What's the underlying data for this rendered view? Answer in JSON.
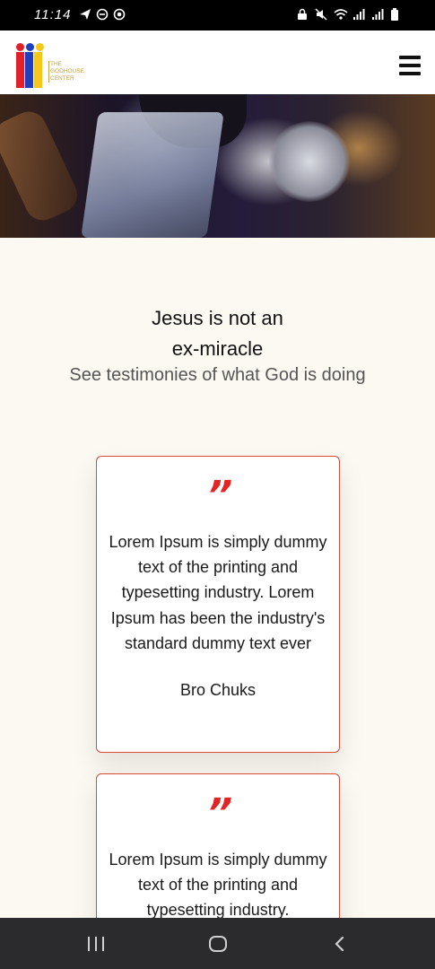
{
  "status_bar": {
    "time": "11:14",
    "left_icons": [
      "telegram-icon",
      "dnd-icon",
      "record-icon"
    ],
    "right_icons": [
      "lock-icon",
      "mute-icon",
      "wifi-icon",
      "signal-icon",
      "signal-icon",
      "battery-icon"
    ]
  },
  "header": {
    "logo_text": [
      "THE",
      "GODHOUSE",
      "CENTER"
    ],
    "logo_colors": {
      "red": "#e0202a",
      "blue": "#1f3fbf",
      "yellow": "#f4c81a"
    },
    "menu_icon": "hamburger-icon"
  },
  "hero": {
    "description_icon": "hero-image"
  },
  "testimonials": {
    "title_line1": "Jesus is not an",
    "title_line2": "ex-miracle",
    "subtitle": "See testimonies of what God is doing",
    "cards": [
      {
        "quote_mark": "”",
        "text": "Lorem Ipsum is simply dummy text of the printing and typesetting industry. Lorem Ipsum has been the industry's standard dummy text ever",
        "author": "Bro Chuks"
      },
      {
        "quote_mark": "”",
        "text": "Lorem Ipsum is simply dummy text of the printing and typesetting industry."
      }
    ]
  },
  "colors": {
    "accent": "#e12424",
    "card_border": "#d84a3a",
    "page_bg": "#fcf9f2"
  },
  "nav_bar": {
    "icons": [
      "recent-apps-icon",
      "home-icon",
      "back-icon"
    ]
  }
}
